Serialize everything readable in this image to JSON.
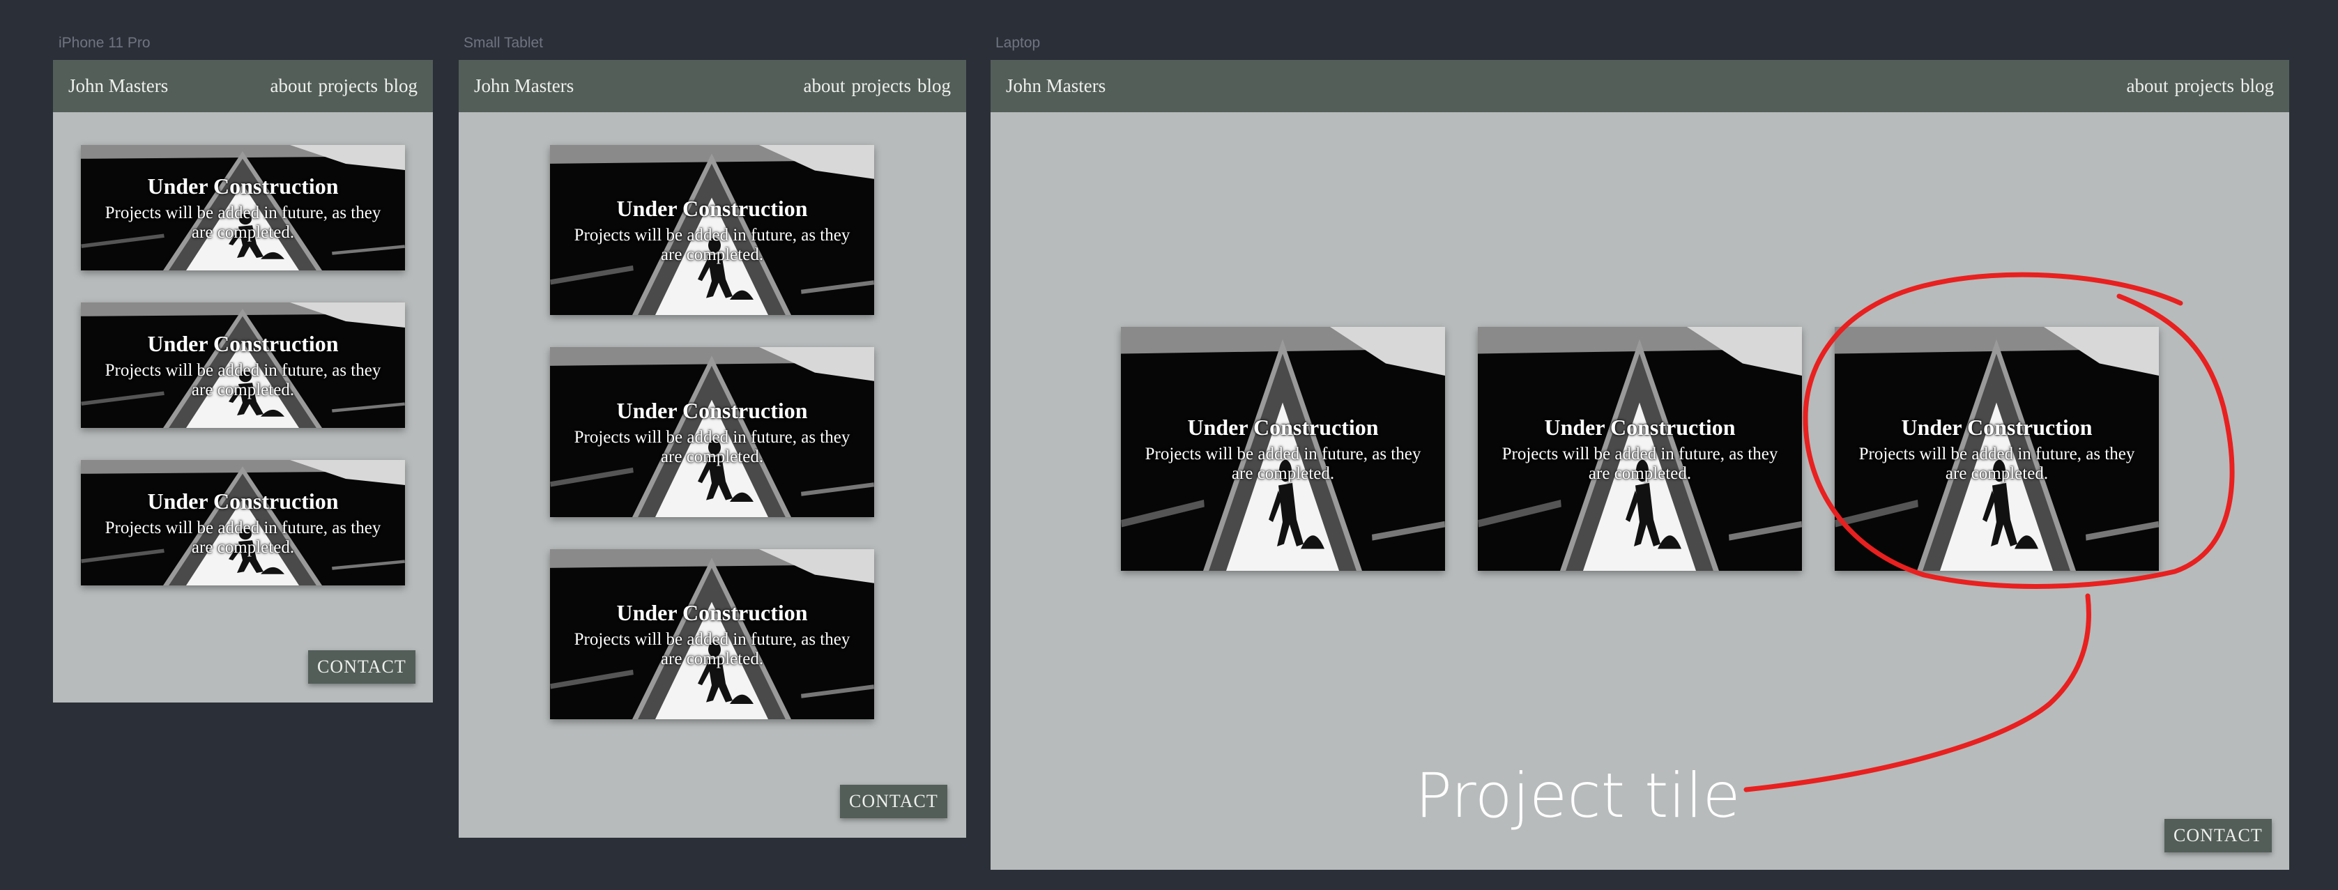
{
  "frames": [
    {
      "label": "iPhone 11 Pro"
    },
    {
      "label": "Small Tablet"
    },
    {
      "label": "Laptop"
    }
  ],
  "header": {
    "name": "John Masters",
    "nav": {
      "about": "about",
      "projects": "projects",
      "blog": "blog"
    }
  },
  "tile": {
    "title": "Under Construction",
    "description": "Projects will be added in future, as they are completed."
  },
  "contact_label": "CONTACT",
  "annotation": {
    "label": "Project tile",
    "color": "#e8201f"
  },
  "colors": {
    "background": "#2b2f38",
    "frame": "#b7bbbb",
    "header": "#535e59",
    "header_text": "#eef0ec"
  },
  "icons": [
    "construction-sign-icon"
  ]
}
